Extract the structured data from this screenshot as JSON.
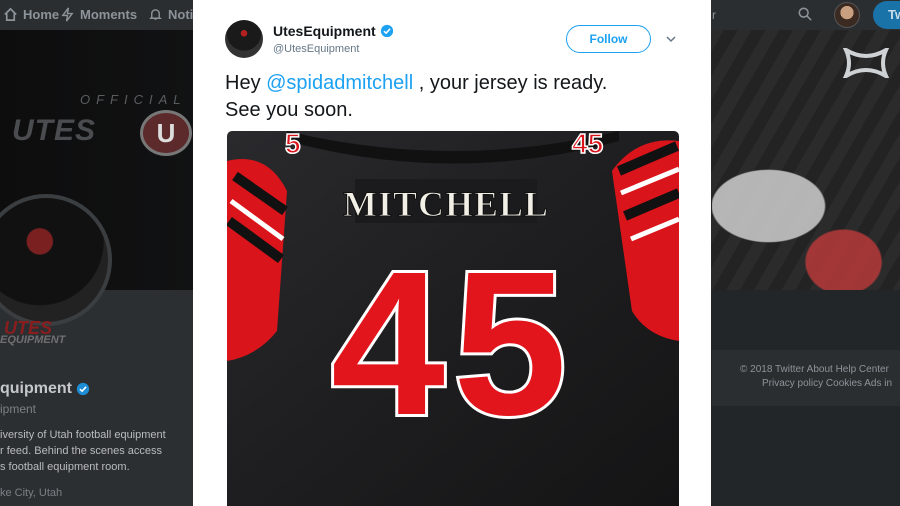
{
  "nav": {
    "home_label": "Home",
    "moments_label": "Moments",
    "notifications_label": "Notifi",
    "tweet_button_label": "Tw",
    "search_fragment": "r"
  },
  "banner": {
    "official_text": "OFFICIAL T",
    "utes_text": "UTES",
    "logo_letter": "U"
  },
  "profile": {
    "avatar_text": "UTES",
    "avatar_subtext": "EQUIPMENT",
    "name": "quipment",
    "handle": "ipment",
    "bio_lines": [
      "iversity of Utah football equipment",
      "r feed. Behind the scenes access",
      "s football equipment room."
    ],
    "location": "ke City, Utah"
  },
  "footer": {
    "line1": "© 2018 Twitter   About   Help Center",
    "line2": "Privacy policy   Cookies   Ads in"
  },
  "tweet": {
    "display_name": "UtesEquipment",
    "handle": "@UtesEquipment",
    "follow_label": "Follow",
    "text_prefix": "Hey ",
    "mention": "@spidadmitchell",
    "text_suffix": " , your jersey is ready.",
    "text_line2": "See you soon.",
    "photo": {
      "jersey_name": "MITCHELL",
      "jersey_number": "45",
      "shoulder_number_left": "5",
      "shoulder_number_right": "45"
    }
  },
  "colors": {
    "accent": "#1da1f2",
    "jersey_red": "#e2141c",
    "jersey_black": "#1e1e20"
  },
  "icons": {
    "home": "home-icon",
    "moments": "lightning-icon",
    "notifications": "bell-icon",
    "search": "search-icon",
    "verified": "verified-badge-icon",
    "caret": "chevron-down-icon",
    "under_armour": "under-armour-logo"
  }
}
